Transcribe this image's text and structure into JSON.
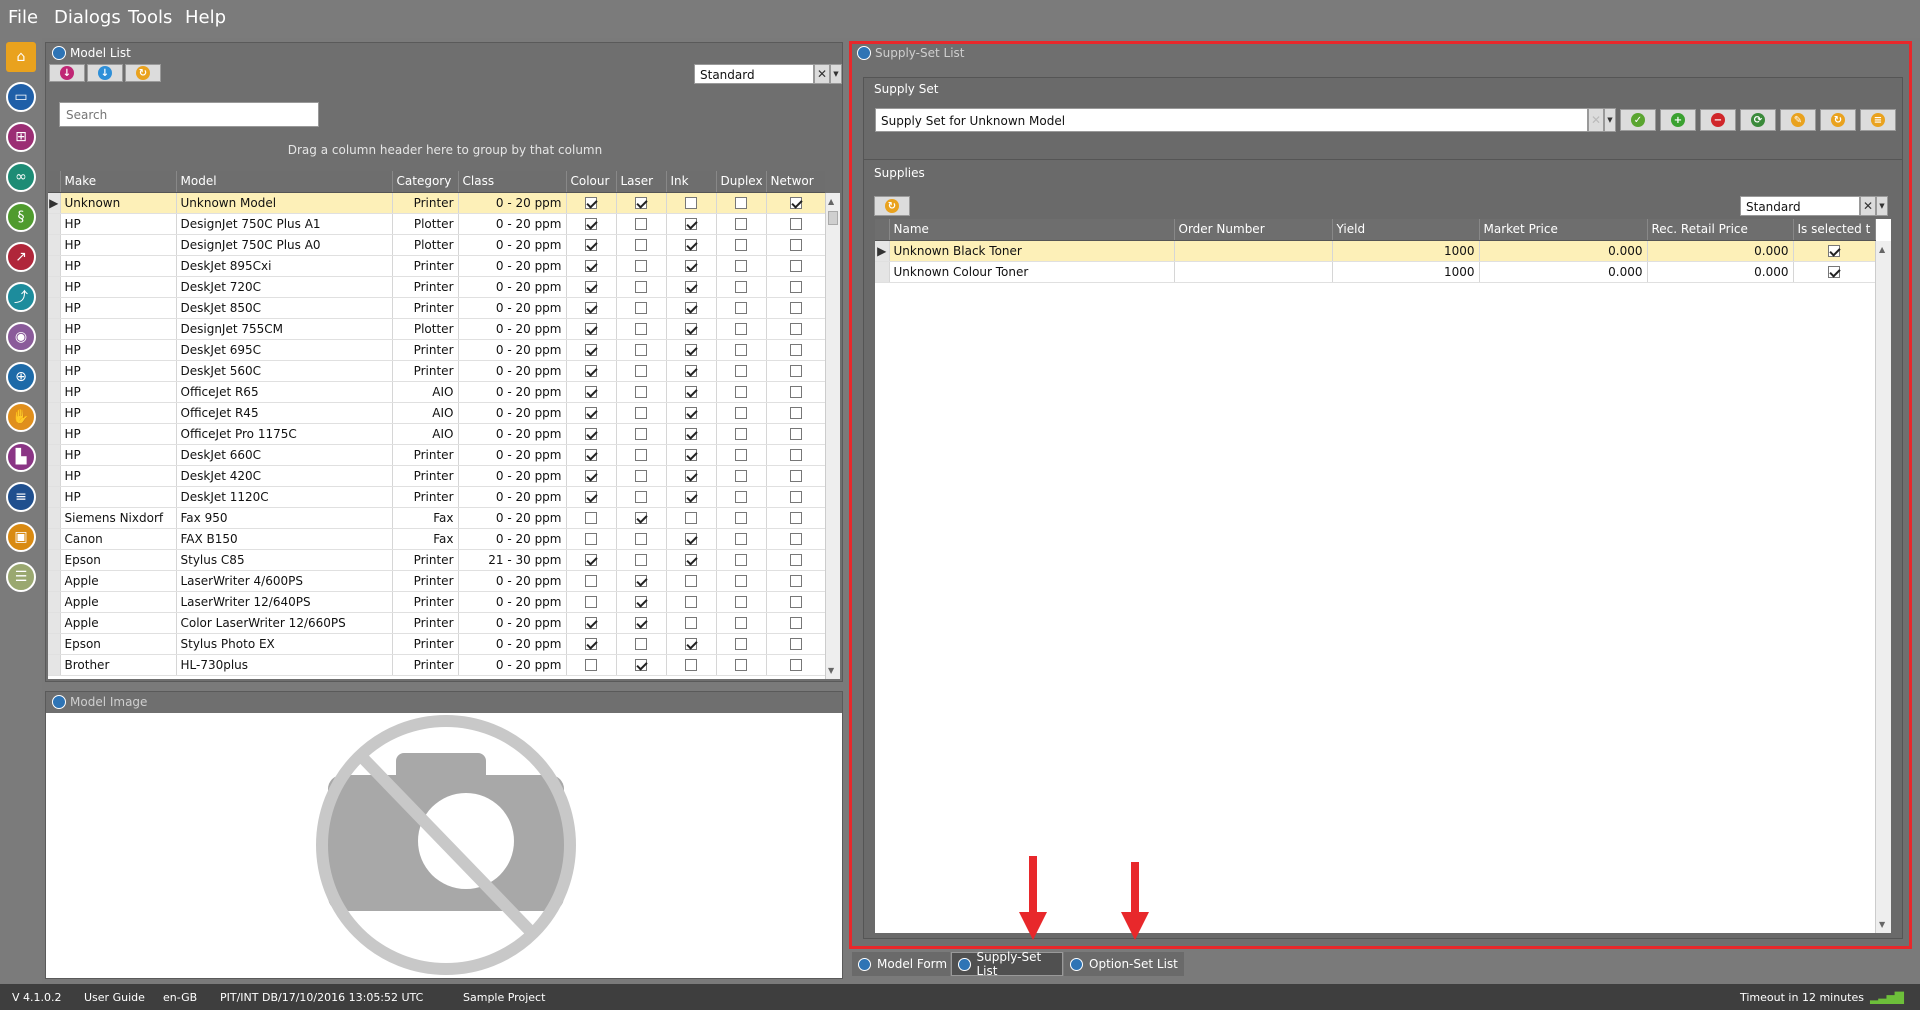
{
  "menu": [
    "File",
    "Dialogs",
    "Tools",
    "Help"
  ],
  "model_list": {
    "title": "Model List",
    "layout_select": "Standard",
    "search_placeholder": "Search",
    "group_hint": "Drag a column header here to group by that column",
    "columns": [
      "Make",
      "Model",
      "Category",
      "Class",
      "Colour",
      "Laser",
      "Ink",
      "Duplex",
      "Networ"
    ],
    "rows": [
      {
        "make": "Unknown",
        "model": "Unknown Model",
        "category": "Printer",
        "class": "0  - 20 ppm",
        "colour": true,
        "laser": true,
        "ink": false,
        "duplex": false,
        "network": true
      },
      {
        "make": "HP",
        "model": "DesignJet 750C Plus A1",
        "category": "Plotter",
        "class": "0  - 20 ppm",
        "colour": true,
        "laser": false,
        "ink": true,
        "duplex": false,
        "network": false
      },
      {
        "make": "HP",
        "model": "DesignJet 750C Plus A0",
        "category": "Plotter",
        "class": "0  - 20 ppm",
        "colour": true,
        "laser": false,
        "ink": true,
        "duplex": false,
        "network": false
      },
      {
        "make": "HP",
        "model": "DeskJet 895Cxi",
        "category": "Printer",
        "class": "0  - 20 ppm",
        "colour": true,
        "laser": false,
        "ink": true,
        "duplex": false,
        "network": false
      },
      {
        "make": "HP",
        "model": "DeskJet 720C",
        "category": "Printer",
        "class": "0  - 20 ppm",
        "colour": true,
        "laser": false,
        "ink": true,
        "duplex": false,
        "network": false
      },
      {
        "make": "HP",
        "model": "DeskJet 850C",
        "category": "Printer",
        "class": "0  - 20 ppm",
        "colour": true,
        "laser": false,
        "ink": true,
        "duplex": false,
        "network": false
      },
      {
        "make": "HP",
        "model": "DesignJet 755CM",
        "category": "Plotter",
        "class": "0  - 20 ppm",
        "colour": true,
        "laser": false,
        "ink": true,
        "duplex": false,
        "network": false
      },
      {
        "make": "HP",
        "model": "DeskJet 695C",
        "category": "Printer",
        "class": "0  - 20 ppm",
        "colour": true,
        "laser": false,
        "ink": true,
        "duplex": false,
        "network": false
      },
      {
        "make": "HP",
        "model": "DeskJet 560C",
        "category": "Printer",
        "class": "0  - 20 ppm",
        "colour": true,
        "laser": false,
        "ink": true,
        "duplex": false,
        "network": false
      },
      {
        "make": "HP",
        "model": "OfficeJet R65",
        "category": "AIO",
        "class": "0  - 20 ppm",
        "colour": true,
        "laser": false,
        "ink": true,
        "duplex": false,
        "network": false
      },
      {
        "make": "HP",
        "model": "OfficeJet R45",
        "category": "AIO",
        "class": "0  - 20 ppm",
        "colour": true,
        "laser": false,
        "ink": true,
        "duplex": false,
        "network": false
      },
      {
        "make": "HP",
        "model": "OfficeJet Pro 1175C",
        "category": "AIO",
        "class": "0  - 20 ppm",
        "colour": true,
        "laser": false,
        "ink": true,
        "duplex": false,
        "network": false
      },
      {
        "make": "HP",
        "model": "DeskJet 660C",
        "category": "Printer",
        "class": "0  - 20 ppm",
        "colour": true,
        "laser": false,
        "ink": true,
        "duplex": false,
        "network": false
      },
      {
        "make": "HP",
        "model": "DeskJet 420C",
        "category": "Printer",
        "class": "0  - 20 ppm",
        "colour": true,
        "laser": false,
        "ink": true,
        "duplex": false,
        "network": false
      },
      {
        "make": "HP",
        "model": "DeskJet 1120C",
        "category": "Printer",
        "class": "0  - 20 ppm",
        "colour": true,
        "laser": false,
        "ink": true,
        "duplex": false,
        "network": false
      },
      {
        "make": "Siemens Nixdorf",
        "model": "Fax 950",
        "category": "Fax",
        "class": "0  - 20 ppm",
        "colour": false,
        "laser": true,
        "ink": false,
        "duplex": false,
        "network": false
      },
      {
        "make": "Canon",
        "model": "FAX B150",
        "category": "Fax",
        "class": "0  - 20 ppm",
        "colour": false,
        "laser": false,
        "ink": true,
        "duplex": false,
        "network": false
      },
      {
        "make": "Epson",
        "model": "Stylus C85",
        "category": "Printer",
        "class": "21 - 30 ppm",
        "colour": true,
        "laser": false,
        "ink": true,
        "duplex": false,
        "network": false
      },
      {
        "make": "Apple",
        "model": "LaserWriter 4/600PS",
        "category": "Printer",
        "class": "0  - 20 ppm",
        "colour": false,
        "laser": true,
        "ink": false,
        "duplex": false,
        "network": false
      },
      {
        "make": "Apple",
        "model": "LaserWriter 12/640PS",
        "category": "Printer",
        "class": "0  - 20 ppm",
        "colour": false,
        "laser": true,
        "ink": false,
        "duplex": false,
        "network": false
      },
      {
        "make": "Apple",
        "model": "Color LaserWriter 12/660PS",
        "category": "Printer",
        "class": "0  - 20 ppm",
        "colour": true,
        "laser": true,
        "ink": false,
        "duplex": false,
        "network": false
      },
      {
        "make": "Epson",
        "model": "Stylus Photo EX",
        "category": "Printer",
        "class": "0  - 20 ppm",
        "colour": true,
        "laser": false,
        "ink": true,
        "duplex": false,
        "network": false
      },
      {
        "make": "Brother",
        "model": "HL-730plus",
        "category": "Printer",
        "class": "0  - 20 ppm",
        "colour": false,
        "laser": true,
        "ink": false,
        "duplex": false,
        "network": false
      }
    ]
  },
  "model_image": {
    "title": "Model Image"
  },
  "supply_set_list": {
    "title": "Supply-Set List",
    "supply_set_label": "Supply Set",
    "supply_set_value": "Supply Set for Unknown Model",
    "supplies_label": "Supplies",
    "layout_select": "Standard",
    "columns": [
      "Name",
      "Order Number",
      "Yield",
      "Market Price",
      "Rec. Retail Price",
      "Is selected t"
    ],
    "rows": [
      {
        "name": "Unknown Black Toner",
        "order_number": "",
        "yield": "1000",
        "market_price": "0.000",
        "retail_price": "0.000",
        "selected": true
      },
      {
        "name": "Unknown Colour Toner",
        "order_number": "",
        "yield": "1000",
        "market_price": "0.000",
        "retail_price": "0.000",
        "selected": true
      }
    ]
  },
  "bottom_tabs": [
    "Model Form",
    "Supply-Set List",
    "Option-Set List"
  ],
  "status": {
    "version": "V 4.1.0.2",
    "user_guide": "User Guide",
    "locale": "en-GB",
    "db": "PIT/INT DB/17/10/2016 13:05:52 UTC",
    "project": "Sample Project",
    "timeout": "Timeout in 12 minutes"
  },
  "icons": [
    "home-icon",
    "folder-icon",
    "hierarchy-icon",
    "binoculars-icon",
    "scroll-icon",
    "chart-icon",
    "trend-icon",
    "eye-icon",
    "target-icon",
    "handshake-icon",
    "bars-icon",
    "document-icon",
    "briefcase-icon",
    "database-icon"
  ],
  "colors": {
    "highlight_border": "#e8282b",
    "selected_row": "#fdf0b8",
    "accent_blue": "#2e74b5"
  }
}
